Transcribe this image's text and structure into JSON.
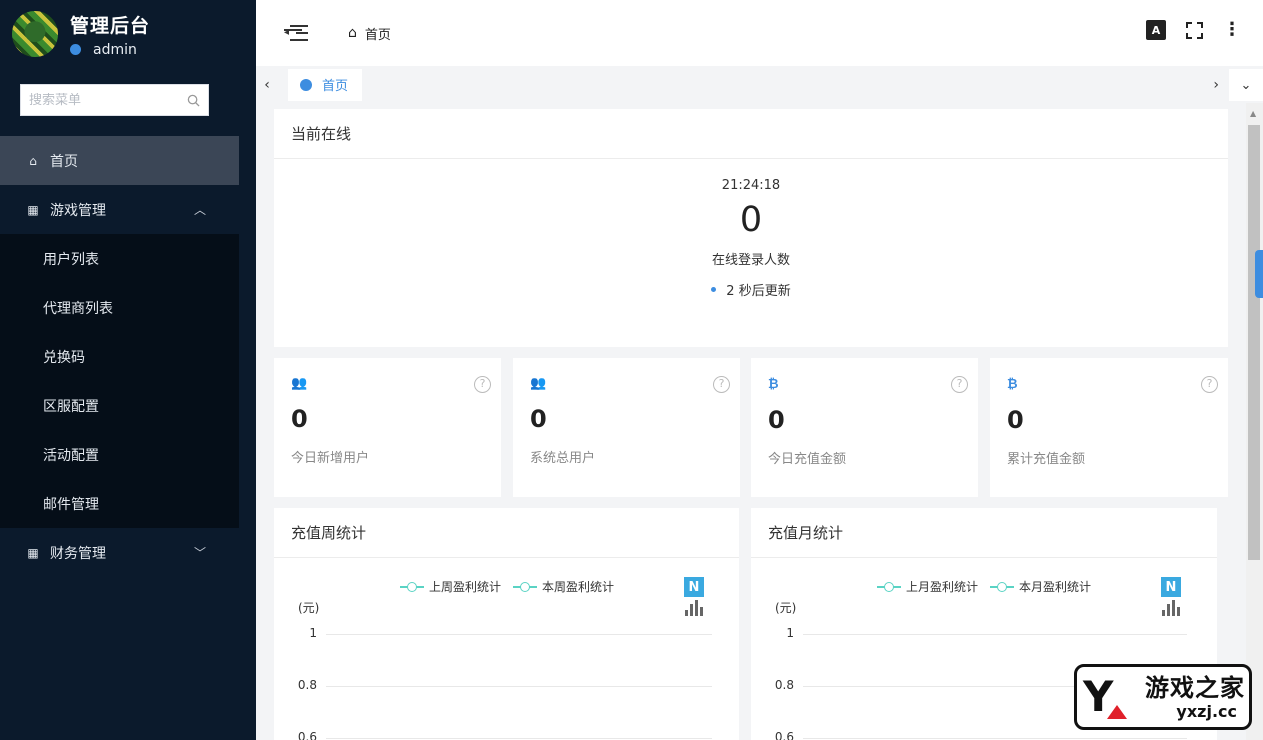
{
  "sidebar": {
    "app_title": "管理后台",
    "username": "admin",
    "search_placeholder": "搜索菜单",
    "items": [
      {
        "label": "首页",
        "icon": "home-icon"
      },
      {
        "label": "游戏管理",
        "icon": "grid-icon"
      },
      {
        "label": "财务管理",
        "icon": "grid-icon"
      }
    ],
    "game_submenu": [
      "用户列表",
      "代理商列表",
      "兑换码",
      "区服配置",
      "活动配置",
      "邮件管理"
    ]
  },
  "topbar": {
    "breadcrumb": "首页",
    "lang_icon_text": "A"
  },
  "tabs": [
    {
      "label": "首页"
    }
  ],
  "online": {
    "title": "当前在线",
    "time": "21:24:18",
    "count": "0",
    "label": "在线登录人数",
    "refresh": "2 秒后更新"
  },
  "stats": [
    {
      "value": "0",
      "label": "今日新增用户",
      "icon": "users-icon"
    },
    {
      "value": "0",
      "label": "系统总用户",
      "icon": "users-icon"
    },
    {
      "value": "0",
      "label": "今日充值金额",
      "icon": "bitcoin-icon"
    },
    {
      "value": "0",
      "label": "累计充值金额",
      "icon": "bitcoin-icon"
    }
  ],
  "charts": {
    "weekly": {
      "title": "充值周统计",
      "legend": [
        "上周盈利统计",
        "本周盈利统计"
      ],
      "unit": "(元)",
      "yticks": [
        "1",
        "0.8",
        "0.6"
      ]
    },
    "monthly": {
      "title": "充值月统计",
      "legend": [
        "上月盈利统计",
        "本月盈利统计"
      ],
      "unit": "(元)",
      "yticks": [
        "1",
        "0.8",
        "0.6"
      ]
    }
  },
  "chart_data": [
    {
      "type": "line",
      "title": "充值周统计",
      "ylabel": "(元)",
      "ylim": [
        0,
        1
      ],
      "series": [
        {
          "name": "上周盈利统计",
          "values": []
        },
        {
          "name": "本周盈利统计",
          "values": []
        }
      ],
      "series_color": "#5ad3c4"
    },
    {
      "type": "line",
      "title": "充值月统计",
      "ylabel": "(元)",
      "ylim": [
        0,
        1
      ],
      "series": [
        {
          "name": "上月盈利统计",
          "values": []
        },
        {
          "name": "本月盈利统计",
          "values": []
        }
      ],
      "series_color": "#5ad3c4"
    }
  ],
  "watermark": {
    "name": "游戏之家",
    "url": "yxzj.cc"
  },
  "colors": {
    "accent": "#3d8de0",
    "sidebar_bg": "#0b1a2c",
    "active_item": "#3b4656",
    "series": "#5ad3c4"
  }
}
